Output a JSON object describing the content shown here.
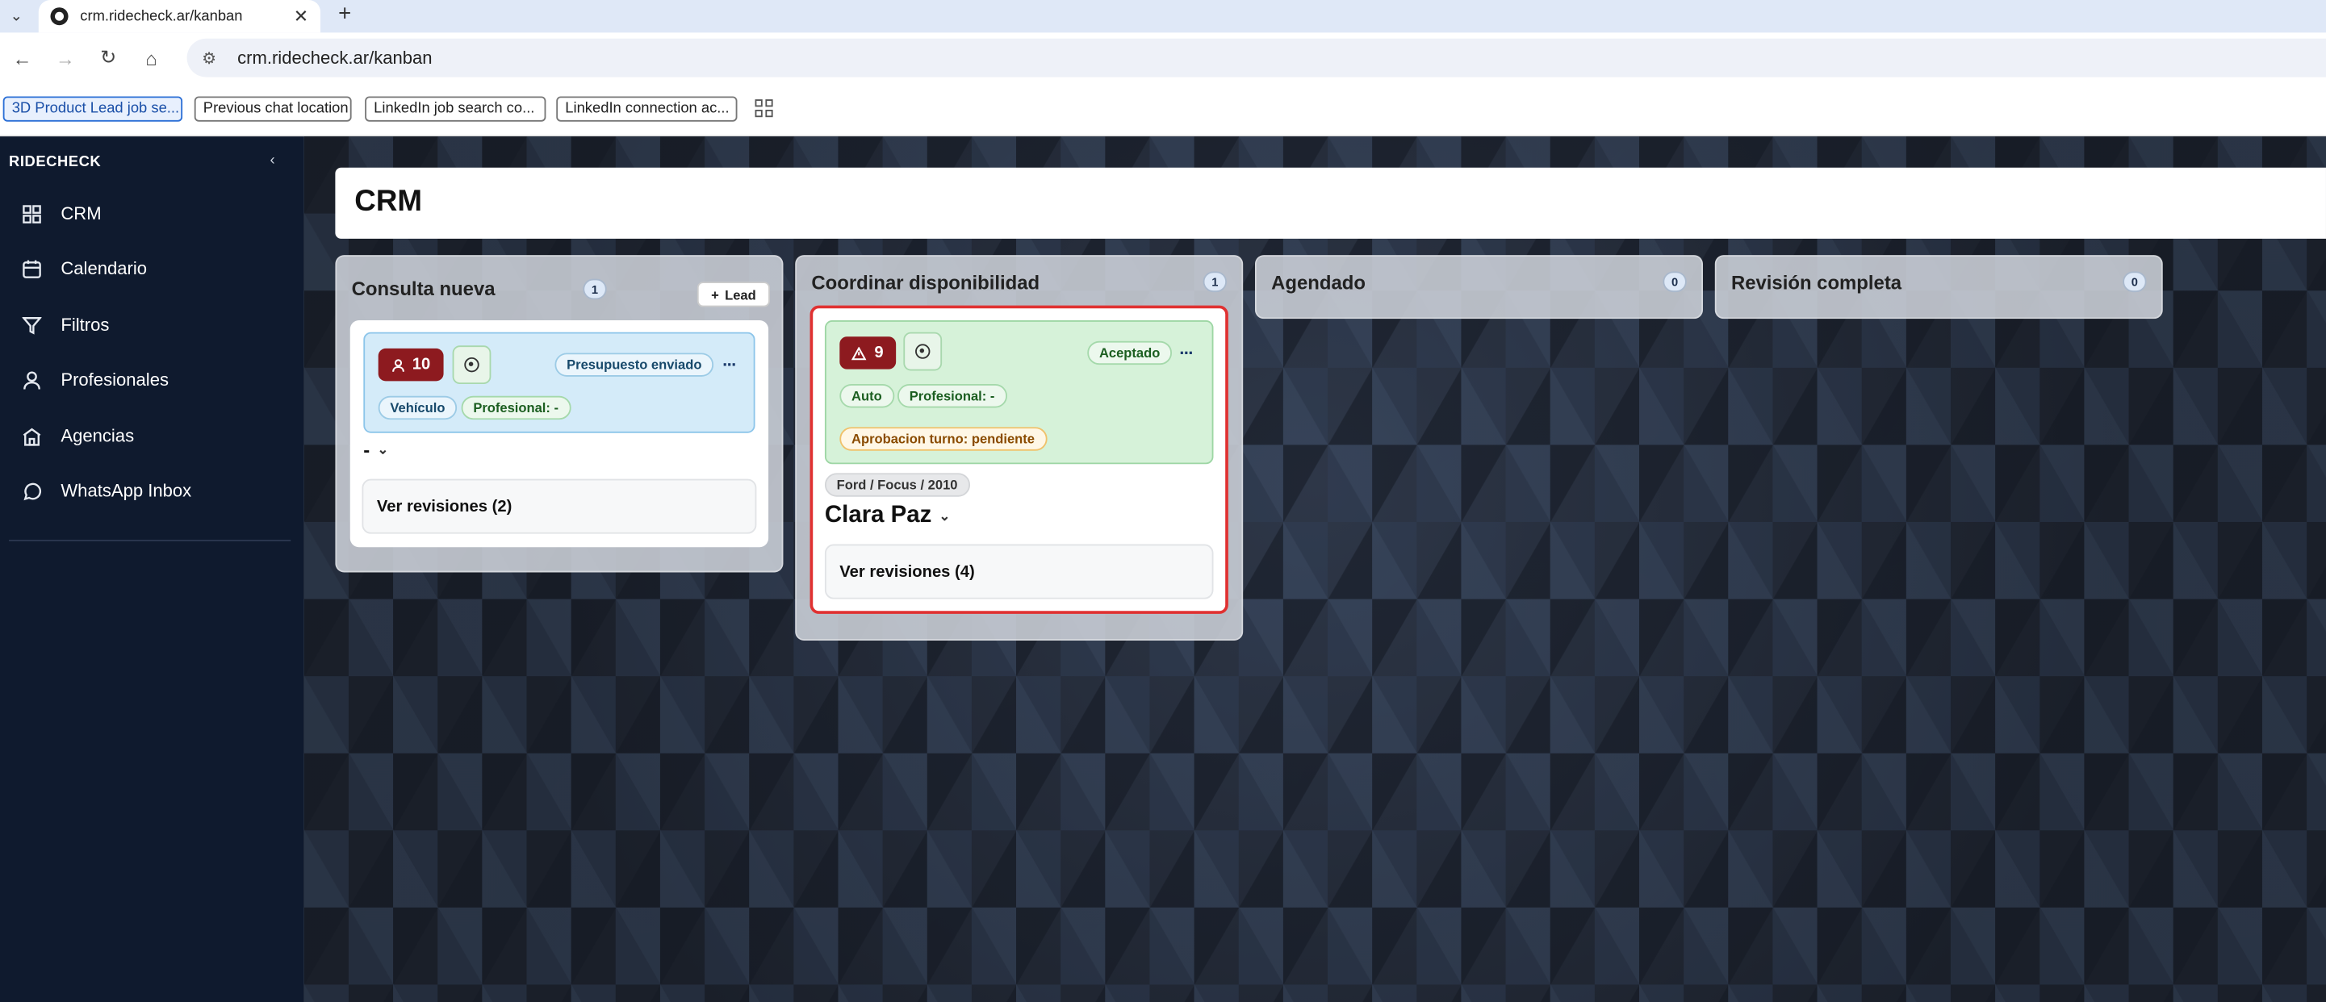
{
  "browser": {
    "tab_title": "crm.ridecheck.ar/kanban",
    "url": "crm.ridecheck.ar/kanban",
    "bookmarks": [
      "3D Product Lead job se...",
      "Previous chat location",
      "LinkedIn job search co...",
      "LinkedIn connection ac..."
    ]
  },
  "sidebar": {
    "brand": "RIDECHECK",
    "items": [
      {
        "label": "CRM",
        "icon": "grid-icon"
      },
      {
        "label": "Calendario",
        "icon": "calendar-icon"
      },
      {
        "label": "Filtros",
        "icon": "filter-icon"
      },
      {
        "label": "Profesionales",
        "icon": "user-icon"
      },
      {
        "label": "Agencias",
        "icon": "building-icon"
      },
      {
        "label": "WhatsApp Inbox",
        "icon": "whatsapp-icon"
      }
    ]
  },
  "page": {
    "title": "CRM"
  },
  "columns": [
    {
      "title": "Consulta nueva",
      "count": "1",
      "add_label": "Lead",
      "card": {
        "badge": "10",
        "status": "Presupuesto enviado",
        "chip1": "Vehículo",
        "chip2": "Profesional: -",
        "name": "-",
        "reviews": "Ver revisiones (2)"
      }
    },
    {
      "title": "Coordinar disponibilidad",
      "count": "1",
      "card": {
        "badge": "9",
        "status": "Aceptado",
        "chip1": "Auto",
        "chip2": "Profesional: -",
        "approval": "Aprobacion turno: pendiente",
        "vehicle": "Ford / Focus / 2010",
        "name": "Clara Paz",
        "reviews": "Ver revisiones (4)"
      }
    },
    {
      "title": "Agendado",
      "count": "0"
    },
    {
      "title": "Revisión completa",
      "count": "0"
    }
  ]
}
